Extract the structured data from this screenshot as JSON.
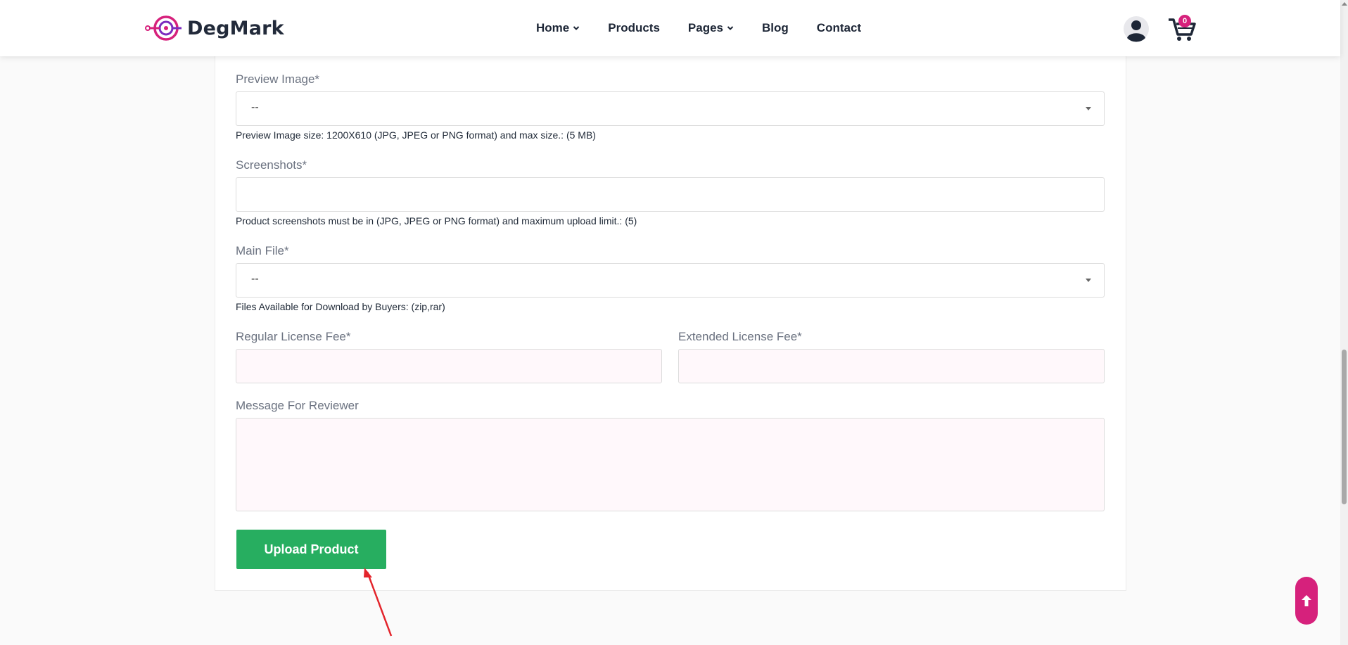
{
  "header": {
    "logo_text": "DegMark",
    "nav": [
      {
        "label": "Home",
        "has_dropdown": true
      },
      {
        "label": "Products",
        "has_dropdown": false
      },
      {
        "label": "Pages",
        "has_dropdown": true
      },
      {
        "label": "Blog",
        "has_dropdown": false
      },
      {
        "label": "Contact",
        "has_dropdown": false
      }
    ],
    "cart_count": "0",
    "user_icon": "user-circle-icon",
    "cart_icon": "shopping-cart-icon"
  },
  "form": {
    "preview_image": {
      "label": "Preview Image*",
      "value": "--",
      "help": "Preview Image size: 1200X610 (JPG, JPEG or PNG format) and max size.: (5 MB)"
    },
    "screenshots": {
      "label": "Screenshots*",
      "value": "",
      "help": "Product screenshots must be in (JPG, JPEG or PNG format) and maximum upload limit.: (5)"
    },
    "main_file": {
      "label": "Main File*",
      "value": "--",
      "help": "Files Available for Download by Buyers: (zip,rar)"
    },
    "regular_license_fee": {
      "label": "Regular License Fee*",
      "value": ""
    },
    "extended_license_fee": {
      "label": "Extended License Fee*",
      "value": ""
    },
    "message_for_reviewer": {
      "label": "Message For Reviewer",
      "value": ""
    },
    "submit_label": "Upload Product"
  },
  "colors": {
    "brand": "#d6217c",
    "submit": "#27ae60",
    "annotation_arrow": "#e3242b"
  },
  "back_to_top_icon": "arrow-up-icon"
}
